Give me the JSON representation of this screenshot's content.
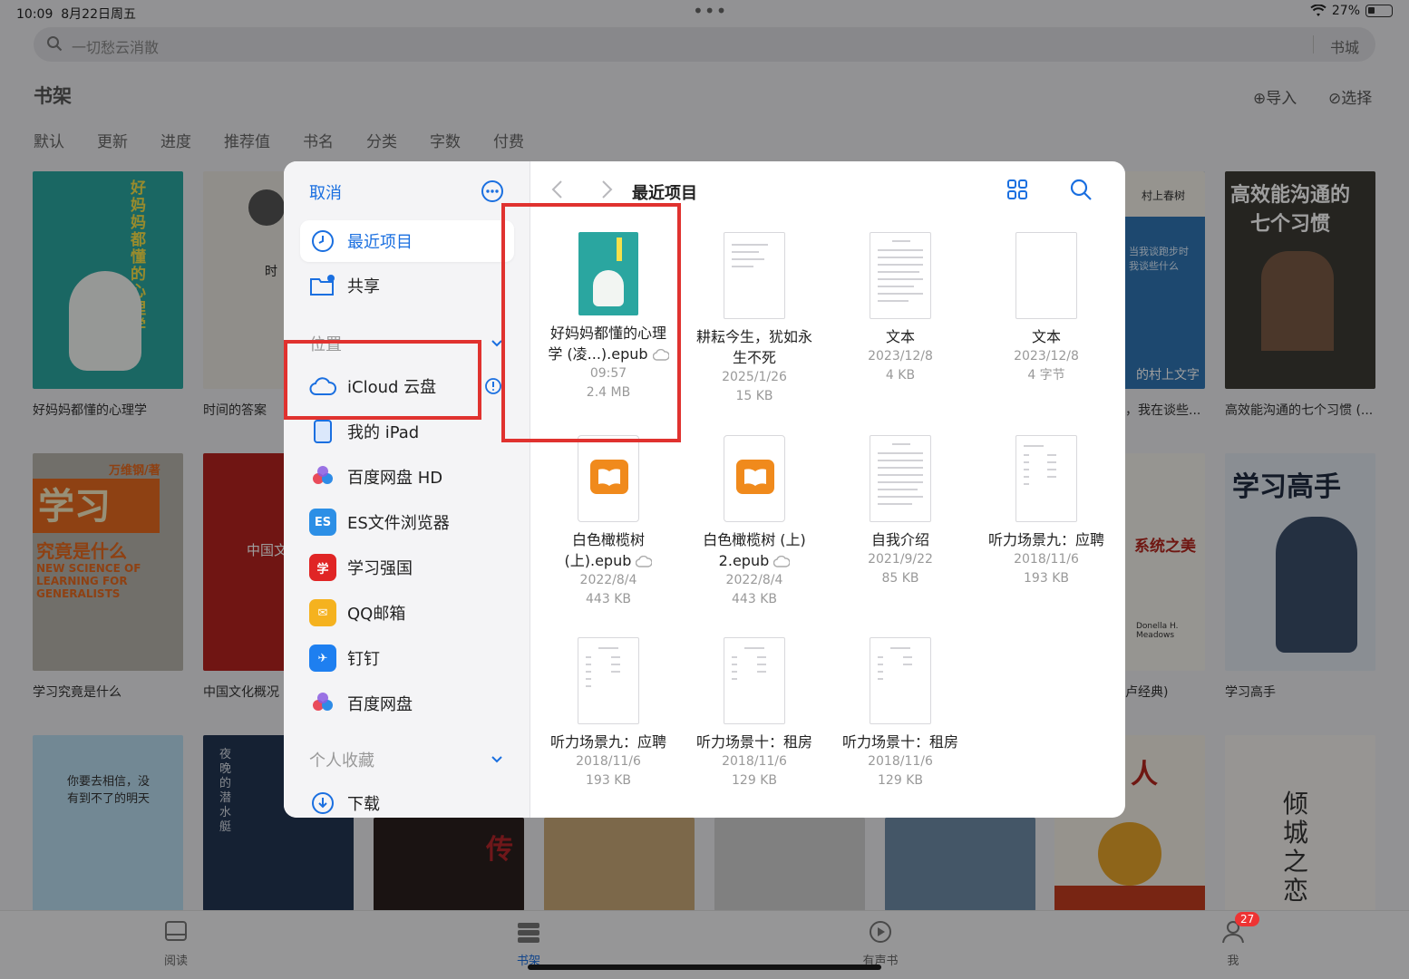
{
  "status": {
    "time": "10:09",
    "date": "8月22日周五",
    "battery": "27%"
  },
  "search": {
    "placeholder": "一切愁云消散",
    "store": "书城"
  },
  "shelf": {
    "title": "书架",
    "import": "⊕导入",
    "select": "⊘选择",
    "sort_tabs": [
      "默认",
      "更新",
      "进度",
      "推荐值",
      "书名",
      "分类",
      "字数",
      "付费"
    ],
    "row1_titles": [
      "好妈妈都懂的心理学",
      "时间的答案",
      "，我在谈些...",
      "高效能沟通的七个习惯 (..."
    ],
    "row2_titles": [
      "学习究竟是什么",
      "中国文化概况（",
      "卢经典)",
      "学习高手"
    ],
    "cover_texts": {
      "b1": "好妈妈都懂的心理学",
      "b2": "时",
      "b3": "村上春树",
      "b3b": "当我谈跑步时我谈些什么",
      "b3c": "的村上文字",
      "b4a": "高效能沟通的",
      "b4b": "七个习惯",
      "b5a": "万维钢/著",
      "b5b": "学习",
      "b5c": "究竟是什么",
      "b5d": "NEW SCIENCE OF LEARNING FOR GENERALISTS",
      "b6": "中国文",
      "b7": "系统之美",
      "b7b": "Donella H. Meadows",
      "b8a": "学习高手",
      "b9": "你要去相信，没有到不了的明天",
      "b10": "夜晚的潜水艇",
      "b11": "传",
      "b12": "人",
      "b13": "倾城之恋"
    }
  },
  "picker": {
    "cancel": "取消",
    "sidebar": {
      "recent": "最近项目",
      "shared": "共享",
      "location_header": "位置",
      "locations": [
        "iCloud 云盘",
        "我的 iPad",
        "百度网盘 HD",
        "ES文件浏览器",
        "学习强国",
        "QQ邮箱",
        "钉钉",
        "百度网盘"
      ],
      "favorites_header": "个人收藏",
      "downloads": "下载"
    },
    "title": "最近项目",
    "files": [
      {
        "name1": "好妈妈都懂的心理",
        "name2": "学 (凌...).epub",
        "meta1": "09:57",
        "meta2": "2.4 MB"
      },
      {
        "name1": "耕耘今生，犹如永",
        "name2": "生不死",
        "meta1": "2025/1/26",
        "meta2": "15 KB"
      },
      {
        "name1": "文本",
        "name2": "",
        "meta1": "2023/12/8",
        "meta2": "4 KB"
      },
      {
        "name1": "文本",
        "name2": "",
        "meta1": "2023/12/8",
        "meta2": "4 字节"
      },
      {
        "name1": "白色橄榄树",
        "name2": "(上).epub",
        "meta1": "2022/8/4",
        "meta2": "443 KB"
      },
      {
        "name1": "白色橄榄树 (上)",
        "name2": "2.epub",
        "meta1": "2022/8/4",
        "meta2": "443 KB"
      },
      {
        "name1": "自我介绍",
        "name2": "",
        "meta1": "2021/9/22",
        "meta2": "85 KB"
      },
      {
        "name1": "听力场景九：应聘",
        "name2": "",
        "meta1": "2018/11/6",
        "meta2": "193 KB"
      },
      {
        "name1": "听力场景九：应聘",
        "name2": "",
        "meta1": "2018/11/6",
        "meta2": "193 KB"
      },
      {
        "name1": "听力场景十：租房",
        "name2": "",
        "meta1": "2018/11/6",
        "meta2": "129 KB"
      },
      {
        "name1": "听力场景十：租房",
        "name2": "",
        "meta1": "2018/11/6",
        "meta2": "129 KB"
      }
    ]
  },
  "tabbar": {
    "read": "阅读",
    "shelf": "书架",
    "audio": "有声书",
    "me": "我",
    "badge": "27"
  },
  "colors": {
    "accent": "#1a6fe0",
    "highlight": "#e0322f"
  }
}
